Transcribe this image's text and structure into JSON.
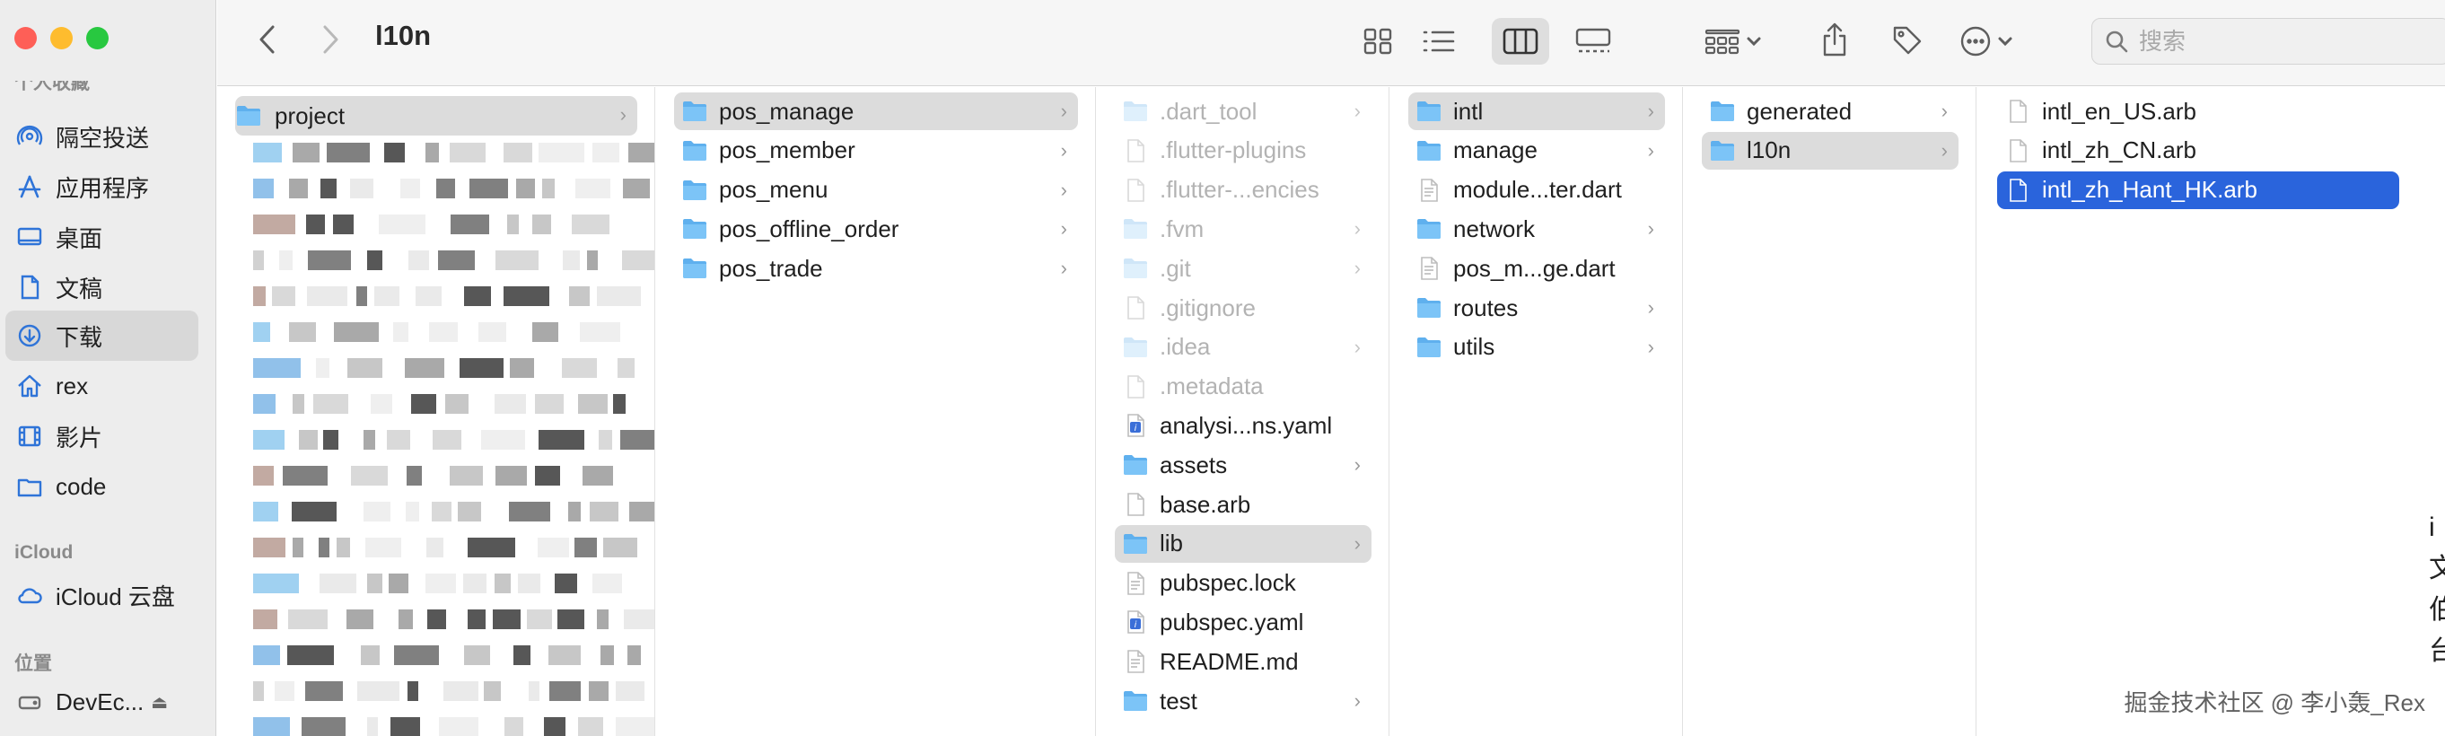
{
  "window": {
    "title": "l10n"
  },
  "sidebar": {
    "section_favorites_partial": "个人收藏",
    "items": [
      {
        "label": "隔空投送",
        "icon": "airdrop-icon"
      },
      {
        "label": "应用程序",
        "icon": "applications-icon"
      },
      {
        "label": "桌面",
        "icon": "desktop-icon"
      },
      {
        "label": "文稿",
        "icon": "document-icon"
      },
      {
        "label": "下载",
        "icon": "download-icon",
        "selected": true
      },
      {
        "label": "rex",
        "icon": "home-icon"
      },
      {
        "label": "影片",
        "icon": "film-icon"
      },
      {
        "label": "code",
        "icon": "folder-icon"
      }
    ],
    "section_icloud": "iCloud",
    "icloud_item": "iCloud 云盘",
    "section_locations": "位置",
    "location_item": "DevEc..."
  },
  "toolbar": {
    "search_placeholder": "搜索",
    "back_icon": "chevron-left-icon",
    "forward_icon": "chevron-right-icon"
  },
  "columns": {
    "col1": {
      "selected": "project"
    },
    "col2": [
      "pos_manage",
      "pos_member",
      "pos_menu",
      "pos_offline_order",
      "pos_trade"
    ],
    "col3": [
      {
        "name": ".dart_tool",
        "type": "folder",
        "dim": true,
        "chevron": true
      },
      {
        "name": ".flutter-plugins",
        "type": "file",
        "dim": true,
        "chevron": false
      },
      {
        "name": ".flutter-...encies",
        "type": "file",
        "dim": true,
        "chevron": false
      },
      {
        "name": ".fvm",
        "type": "folder",
        "dim": true,
        "chevron": true
      },
      {
        "name": ".git",
        "type": "folder",
        "dim": true,
        "chevron": true
      },
      {
        "name": ".gitignore",
        "type": "file",
        "dim": true,
        "chevron": false
      },
      {
        "name": ".idea",
        "type": "folder",
        "dim": true,
        "chevron": true
      },
      {
        "name": ".metadata",
        "type": "file",
        "dim": true,
        "chevron": false
      },
      {
        "name": "analysi...ns.yaml",
        "type": "yaml",
        "dim": false,
        "chevron": false
      },
      {
        "name": "assets",
        "type": "folder",
        "dim": false,
        "chevron": true
      },
      {
        "name": "base.arb",
        "type": "file",
        "dim": false,
        "chevron": false
      },
      {
        "name": "lib",
        "type": "folder",
        "dim": false,
        "chevron": true
      },
      {
        "name": "pubspec.lock",
        "type": "text",
        "dim": false,
        "chevron": false
      },
      {
        "name": "pubspec.yaml",
        "type": "yaml",
        "dim": false,
        "chevron": false
      },
      {
        "name": "README.md",
        "type": "text",
        "dim": false,
        "chevron": false
      },
      {
        "name": "test",
        "type": "folder",
        "dim": false,
        "chevron": true
      }
    ],
    "col4": [
      {
        "name": "intl",
        "type": "folder",
        "chevron": true
      },
      {
        "name": "manage",
        "type": "folder",
        "chevron": true
      },
      {
        "name": "module...ter.dart",
        "type": "text",
        "chevron": false
      },
      {
        "name": "network",
        "type": "folder",
        "chevron": true
      },
      {
        "name": "pos_m...ge.dart",
        "type": "text",
        "chevron": false
      },
      {
        "name": "routes",
        "type": "folder",
        "chevron": true
      },
      {
        "name": "utils",
        "type": "folder",
        "chevron": true
      }
    ],
    "col5": [
      "generated",
      "l10n"
    ],
    "col6": [
      "intl_en_US.arb",
      "intl_zh_CN.arb",
      "intl_zh_Hant_HK.arb"
    ]
  },
  "watermark": "掘金技术社区 @ 李小轰_Rex",
  "edge_peek": "i\n文\n伯\n台"
}
